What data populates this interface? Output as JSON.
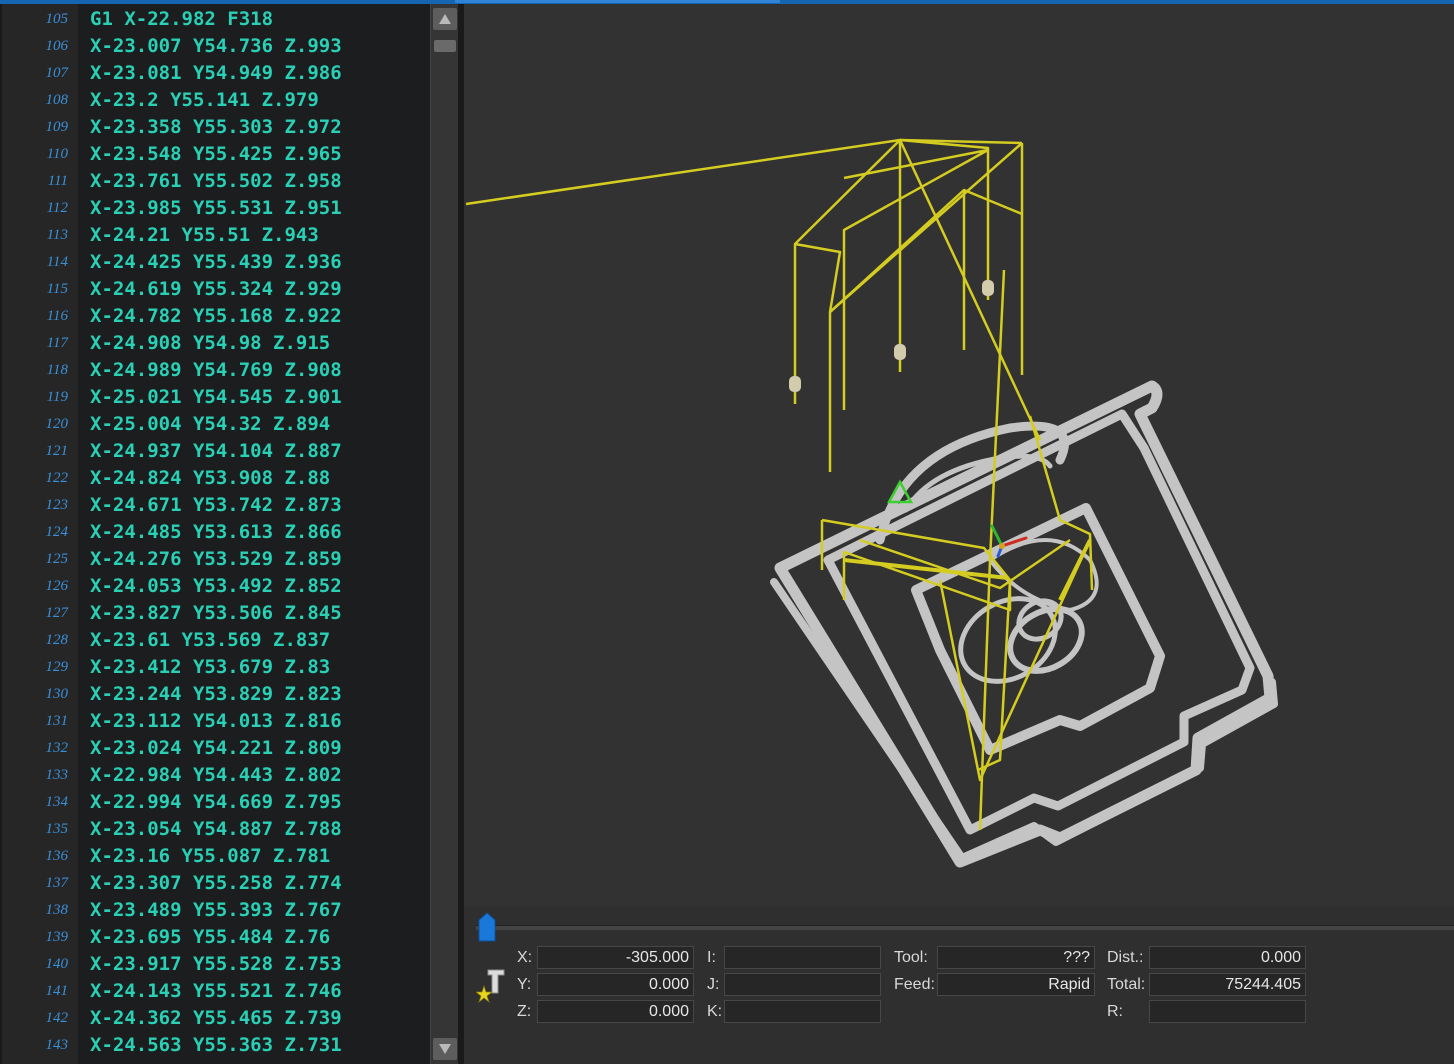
{
  "editor": {
    "lines": [
      {
        "n": "105",
        "code": "G1 X-22.982 F318"
      },
      {
        "n": "106",
        "code": "X-23.007 Y54.736 Z.993"
      },
      {
        "n": "107",
        "code": "X-23.081 Y54.949 Z.986"
      },
      {
        "n": "108",
        "code": "X-23.2 Y55.141 Z.979"
      },
      {
        "n": "109",
        "code": "X-23.358 Y55.303 Z.972"
      },
      {
        "n": "110",
        "code": "X-23.548 Y55.425 Z.965"
      },
      {
        "n": "111",
        "code": "X-23.761 Y55.502 Z.958"
      },
      {
        "n": "112",
        "code": "X-23.985 Y55.531 Z.951"
      },
      {
        "n": "113",
        "code": "X-24.21 Y55.51 Z.943"
      },
      {
        "n": "114",
        "code": "X-24.425 Y55.439 Z.936"
      },
      {
        "n": "115",
        "code": "X-24.619 Y55.324 Z.929"
      },
      {
        "n": "116",
        "code": "X-24.782 Y55.168 Z.922"
      },
      {
        "n": "117",
        "code": "X-24.908 Y54.98 Z.915"
      },
      {
        "n": "118",
        "code": "X-24.989 Y54.769 Z.908"
      },
      {
        "n": "119",
        "code": "X-25.021 Y54.545 Z.901"
      },
      {
        "n": "120",
        "code": "X-25.004 Y54.32 Z.894"
      },
      {
        "n": "121",
        "code": "X-24.937 Y54.104 Z.887"
      },
      {
        "n": "122",
        "code": "X-24.824 Y53.908 Z.88"
      },
      {
        "n": "123",
        "code": "X-24.671 Y53.742 Z.873"
      },
      {
        "n": "124",
        "code": "X-24.485 Y53.613 Z.866"
      },
      {
        "n": "125",
        "code": "X-24.276 Y53.529 Z.859"
      },
      {
        "n": "126",
        "code": "X-24.053 Y53.492 Z.852"
      },
      {
        "n": "127",
        "code": "X-23.827 Y53.506 Z.845"
      },
      {
        "n": "128",
        "code": "X-23.61 Y53.569 Z.837"
      },
      {
        "n": "129",
        "code": "X-23.412 Y53.679 Z.83"
      },
      {
        "n": "130",
        "code": "X-23.244 Y53.829 Z.823"
      },
      {
        "n": "131",
        "code": "X-23.112 Y54.013 Z.816"
      },
      {
        "n": "132",
        "code": "X-23.024 Y54.221 Z.809"
      },
      {
        "n": "133",
        "code": "X-22.984 Y54.443 Z.802"
      },
      {
        "n": "134",
        "code": "X-22.994 Y54.669 Z.795"
      },
      {
        "n": "135",
        "code": "X-23.054 Y54.887 Z.788"
      },
      {
        "n": "136",
        "code": "X-23.16 Y55.087 Z.781"
      },
      {
        "n": "137",
        "code": "X-23.307 Y55.258 Z.774"
      },
      {
        "n": "138",
        "code": "X-23.489 Y55.393 Z.767"
      },
      {
        "n": "139",
        "code": "X-23.695 Y55.484 Z.76"
      },
      {
        "n": "140",
        "code": "X-23.917 Y55.528 Z.753"
      },
      {
        "n": "141",
        "code": "X-24.143 Y55.521 Z.746"
      },
      {
        "n": "142",
        "code": "X-24.362 Y55.465 Z.739"
      },
      {
        "n": "143",
        "code": "X-24.563 Y55.363 Z.731"
      }
    ]
  },
  "colors": {
    "code_text": "#2ad0b5",
    "line_numbers": "#3a8fd6",
    "toolpath_feed": "#d4cc20",
    "part_geometry": "#c4c4c4",
    "accent": "#1565b3"
  },
  "icons": {
    "scroll_up": "triangle-up-icon",
    "scroll_down": "triangle-down-icon",
    "slider_handle": "pentagon-marker-icon",
    "tool": "tool-star-icon",
    "tool_marker": "triangle-outline-icon",
    "axis_gizmo": "xyz-axes-icon"
  },
  "simulation": {
    "progress": 0.0
  },
  "readout": {
    "x_label": "X:",
    "x_value": "-305.000",
    "y_label": "Y:",
    "y_value": "0.000",
    "z_label": "Z:",
    "z_value": "0.000",
    "i_label": "I:",
    "i_value": "",
    "j_label": "J:",
    "j_value": "",
    "k_label": "K:",
    "k_value": "",
    "tool_label": "Tool:",
    "tool_value": "???",
    "feed_label": "Feed:",
    "feed_value": "Rapid",
    "dist_label": "Dist.:",
    "dist_value": "0.000",
    "total_label": "Total:",
    "total_value": "75244.405",
    "r_label": "R:",
    "r_value": ""
  }
}
